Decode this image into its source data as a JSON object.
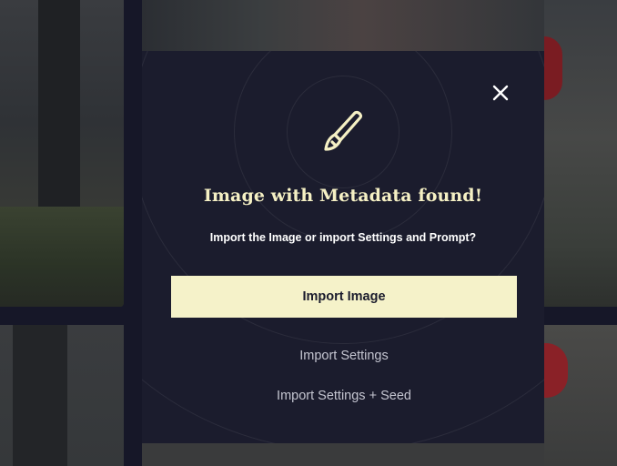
{
  "dialog": {
    "title": "Image with Metadata found!",
    "subtitle": "Import the Image or import Settings and Prompt?",
    "icon": "paintbrush-icon",
    "close_icon": "close-icon",
    "buttons": {
      "import_image": "Import Image",
      "import_settings": "Import Settings",
      "import_settings_seed": "Import Settings + Seed"
    },
    "colors": {
      "accent": "#f5f2c9",
      "dialog_bg": "#1b1c2d",
      "secondary_text": "#c4c5d0"
    }
  }
}
